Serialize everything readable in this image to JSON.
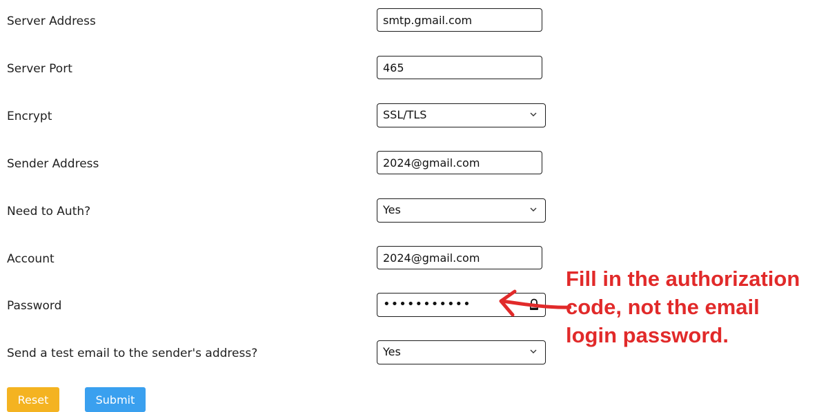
{
  "fields": [
    {
      "label": "Server Address",
      "type": "text",
      "value": "smtp.gmail.com"
    },
    {
      "label": "Server Port",
      "type": "text",
      "value": "465"
    },
    {
      "label": "Encrypt",
      "type": "select",
      "value": "SSL/TLS"
    },
    {
      "label": "Sender Address",
      "type": "text",
      "value": "2024@gmail.com"
    },
    {
      "label": "Need to Auth?",
      "type": "select",
      "value": "Yes"
    },
    {
      "label": "Account",
      "type": "text",
      "value": "2024@gmail.com"
    },
    {
      "label": "Password",
      "type": "password",
      "value": "•••••••••••"
    },
    {
      "label": "Send a test email to the sender's address?",
      "type": "select",
      "value": "Yes"
    }
  ],
  "buttons": {
    "reset_label": "Reset",
    "submit_label": "Submit"
  },
  "annotation": {
    "lines": [
      "Fill in the authorization",
      "code, not the email",
      "login password."
    ],
    "color": "#e12a2a"
  },
  "colors": {
    "reset": "#f4b321",
    "submit": "#3aa0ef"
  },
  "icons": {
    "select_indicator": "chevron-down-icon",
    "password_indicator": "lock-icon"
  }
}
